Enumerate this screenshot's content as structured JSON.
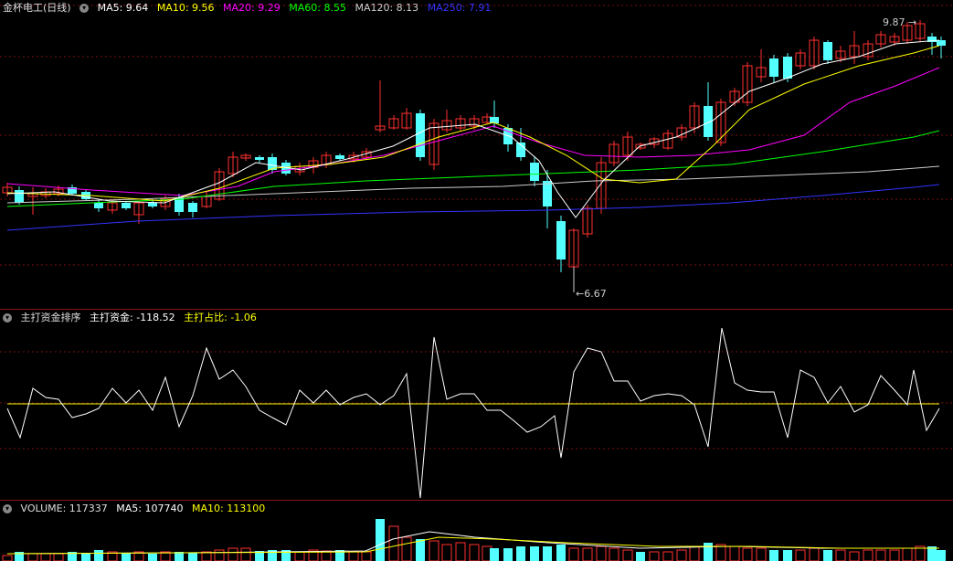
{
  "price": {
    "title": "金杯电工(日线)",
    "ma5": "MA5: 9.64",
    "ma10": "MA10: 9.56",
    "ma20": "MA20: 9.29",
    "ma60": "MA60: 8.55",
    "ma120": "MA120: 8.13",
    "ma250": "MA250: 7.91",
    "high_label": "9.87",
    "low_label": "6.67",
    "colors": {
      "ma5": "#ffffff",
      "ma10": "#ffff00",
      "ma20": "#ff00ff",
      "ma60": "#00ff00",
      "ma120": "#cccccc",
      "ma250": "#3333ff",
      "up": "#ff3030",
      "down": "#54ffff"
    }
  },
  "flow": {
    "title": "主打资金排序",
    "amount_label": "主打资金: -118.52",
    "ratio_label": "主打占比: -1.06"
  },
  "volume": {
    "title": "VOLUME: 117337",
    "ma5": "MA5: 107740",
    "ma10": "MA10: 113100"
  }
}
